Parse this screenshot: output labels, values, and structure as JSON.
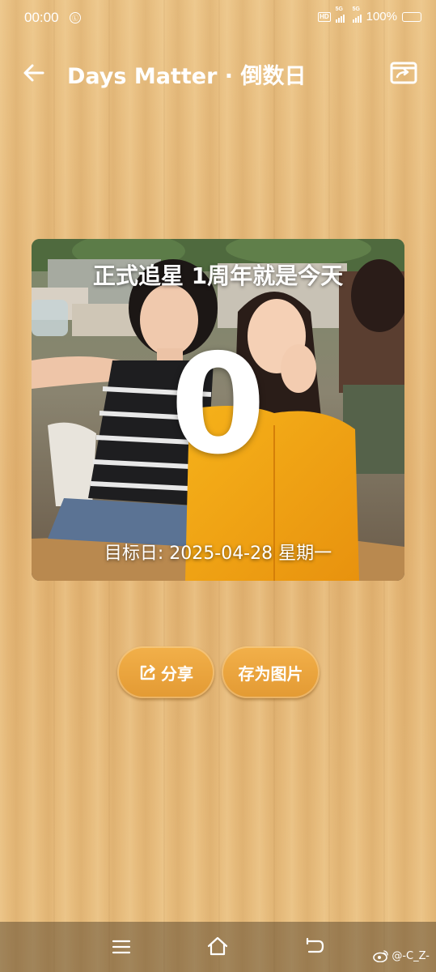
{
  "status_bar": {
    "time": "00:00",
    "small_badge": "Ⓛ",
    "hd_label": "HD",
    "signal1_label": "5G",
    "signal2_label": "5G",
    "battery": "100%"
  },
  "app_bar": {
    "title": "Days Matter · 倒数日"
  },
  "card": {
    "event_title": "正式追星 1周年就是今天",
    "days": "0",
    "target_date": "目标日: 2025-04-28 星期一"
  },
  "actions": {
    "share_label": "分享",
    "save_image_label": "存为图片"
  },
  "watermark": {
    "text": "@-C_Z-"
  },
  "icons": {
    "back": "arrow-left-icon",
    "switch": "screen-switch-icon",
    "share": "share-icon",
    "nav_menu": "menu-icon",
    "nav_home": "home-icon",
    "nav_back": "back-icon",
    "weibo": "weibo-icon"
  },
  "colors": {
    "button": "#e9a13d",
    "text": "#ffffff",
    "wood": "#e5b877"
  }
}
